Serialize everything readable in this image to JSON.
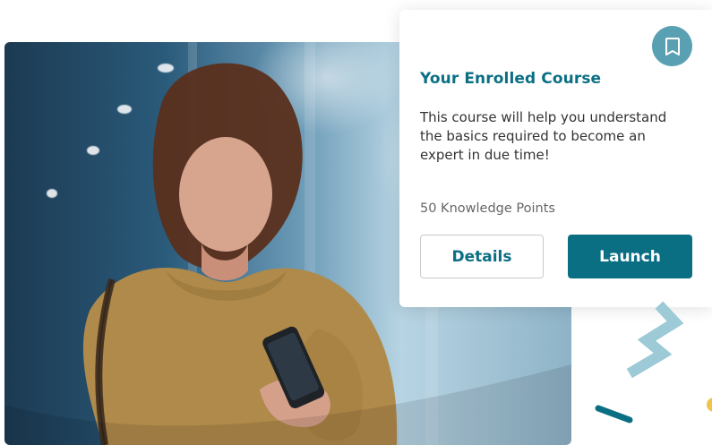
{
  "card": {
    "title": "Your Enrolled Course",
    "description": "This course will help you understand the basics required to become an expert in due time!",
    "points": "50 Knowledge Points",
    "buttons": {
      "details": "Details",
      "launch": "Launch"
    },
    "bookmark_icon": "bookmark-icon"
  },
  "colors": {
    "accent": "#0b6f84",
    "bookmark_bg": "#5aa0b3",
    "zigzag": "#9ccad6",
    "dot": "#f2c14e"
  }
}
